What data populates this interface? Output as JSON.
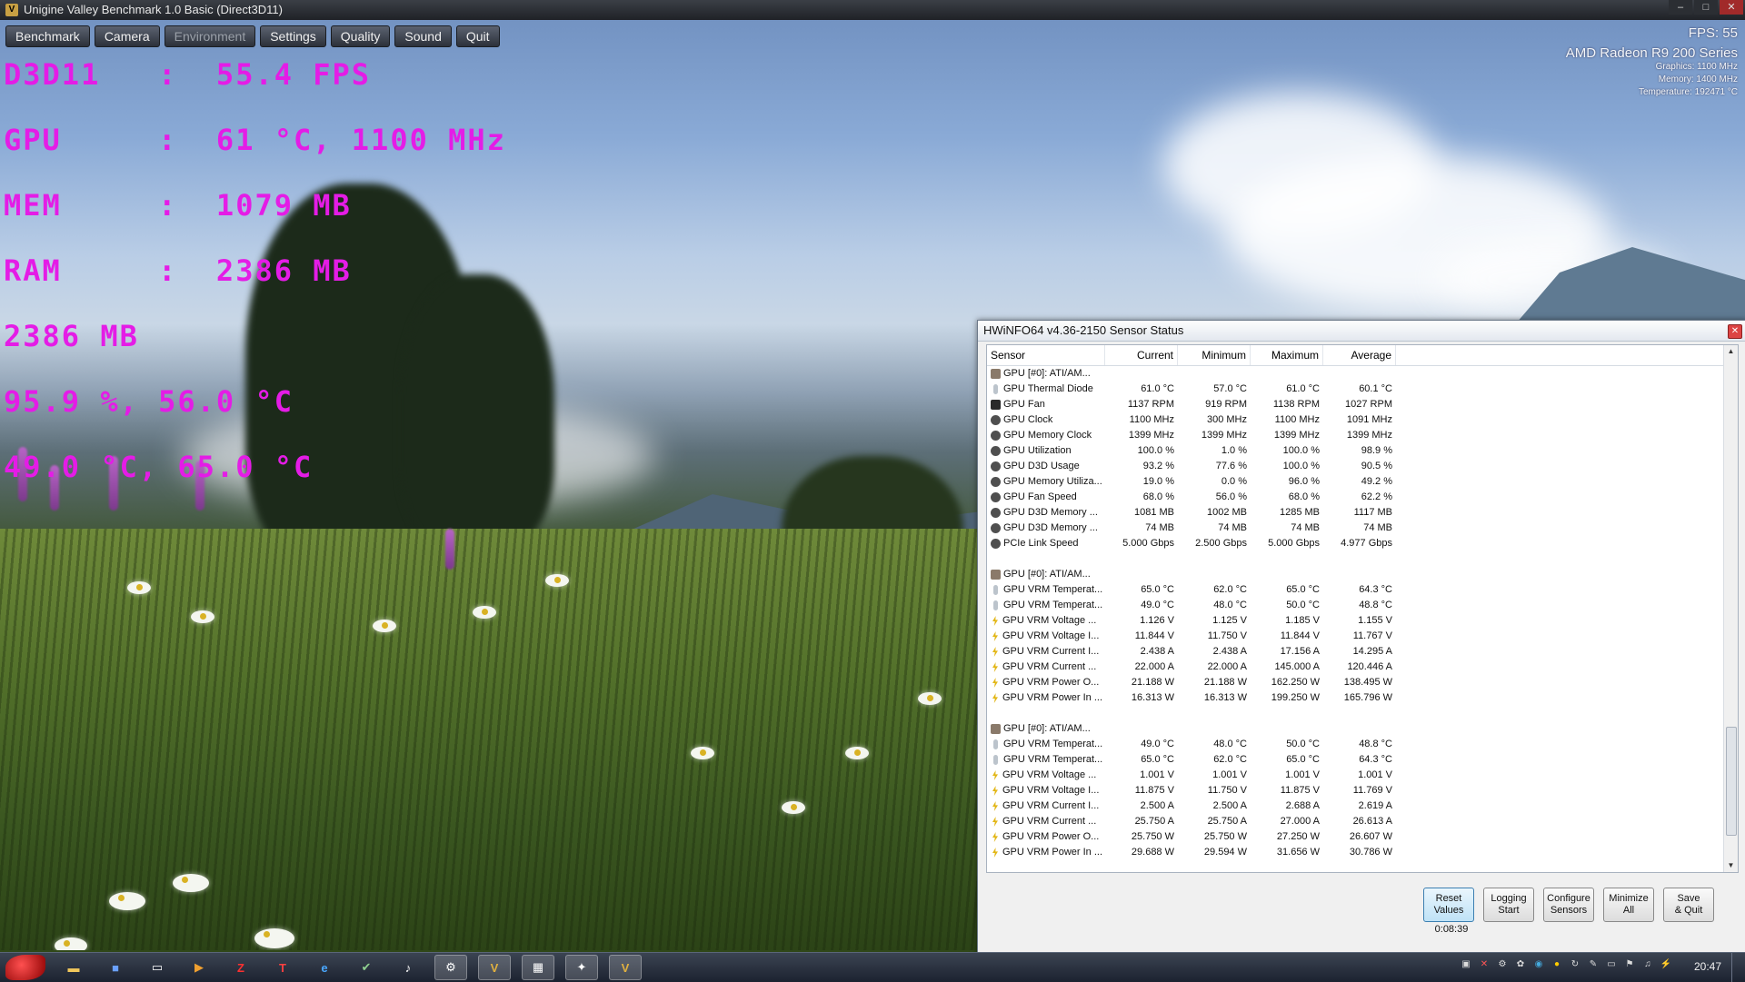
{
  "window": {
    "title": "Unigine Valley Benchmark 1.0 Basic (Direct3D11)"
  },
  "unigine_menu": [
    "Benchmark",
    "Camera",
    "Environment",
    "Settings",
    "Quality",
    "Sound",
    "Quit"
  ],
  "osd_lines": [
    "D3D11   :  55.4 FPS",
    "GPU     :  61 °C, 1100 MHz",
    "MEM     :  1079 MB",
    "RAM     :  2386 MB",
    "2386 MB",
    "95.9 %, 56.0 °C",
    "49.0 °C, 65.0 °C"
  ],
  "overlay": {
    "fps": "FPS: 55",
    "gpu_name": "AMD Radeon R9 200 Series",
    "graphics": "Graphics: 1100 MHz",
    "memory": "Memory: 1400 MHz",
    "temperature": "Temperature: 192471 °C"
  },
  "hwinfo": {
    "title": "HWiNFO64 v4.36-2150 Sensor Status",
    "columns": [
      "Sensor",
      "Current",
      "Minimum",
      "Maximum",
      "Average"
    ],
    "rows": [
      {
        "icon": "board",
        "name": "GPU [#0]: ATI/AM...",
        "cur": "",
        "min": "",
        "max": "",
        "avg": ""
      },
      {
        "icon": "therm",
        "name": "GPU Thermal Diode",
        "cur": "61.0 °C",
        "min": "57.0 °C",
        "max": "61.0 °C",
        "avg": "60.1 °C"
      },
      {
        "icon": "fan",
        "name": "GPU Fan",
        "cur": "1137 RPM",
        "min": "919 RPM",
        "max": "1138 RPM",
        "avg": "1027 RPM"
      },
      {
        "icon": "gauge",
        "name": "GPU Clock",
        "cur": "1100 MHz",
        "min": "300 MHz",
        "max": "1100 MHz",
        "avg": "1091 MHz"
      },
      {
        "icon": "gauge",
        "name": "GPU Memory Clock",
        "cur": "1399 MHz",
        "min": "1399 MHz",
        "max": "1399 MHz",
        "avg": "1399 MHz"
      },
      {
        "icon": "gauge",
        "name": "GPU Utilization",
        "cur": "100.0 %",
        "min": "1.0 %",
        "max": "100.0 %",
        "avg": "98.9 %"
      },
      {
        "icon": "gauge",
        "name": "GPU D3D Usage",
        "cur": "93.2 %",
        "min": "77.6 %",
        "max": "100.0 %",
        "avg": "90.5 %"
      },
      {
        "icon": "gauge",
        "name": "GPU Memory Utiliza...",
        "cur": "19.0 %",
        "min": "0.0 %",
        "max": "96.0 %",
        "avg": "49.2 %"
      },
      {
        "icon": "gauge",
        "name": "GPU Fan Speed",
        "cur": "68.0 %",
        "min": "56.0 %",
        "max": "68.0 %",
        "avg": "62.2 %"
      },
      {
        "icon": "gauge",
        "name": "GPU D3D Memory ...",
        "cur": "1081 MB",
        "min": "1002 MB",
        "max": "1285 MB",
        "avg": "1117 MB"
      },
      {
        "icon": "gauge",
        "name": "GPU D3D Memory ...",
        "cur": "74 MB",
        "min": "74 MB",
        "max": "74 MB",
        "avg": "74 MB"
      },
      {
        "icon": "gauge",
        "name": "PCIe Link Speed",
        "cur": "5.000 Gbps",
        "min": "2.500 Gbps",
        "max": "5.000 Gbps",
        "avg": "4.977 Gbps"
      },
      {
        "icon": "blank",
        "name": "",
        "cur": "",
        "min": "",
        "max": "",
        "avg": ""
      },
      {
        "icon": "board",
        "name": "GPU [#0]: ATI/AM...",
        "cur": "",
        "min": "",
        "max": "",
        "avg": ""
      },
      {
        "icon": "therm",
        "name": "GPU VRM Temperat...",
        "cur": "65.0 °C",
        "min": "62.0 °C",
        "max": "65.0 °C",
        "avg": "64.3 °C"
      },
      {
        "icon": "therm",
        "name": "GPU VRM Temperat...",
        "cur": "49.0 °C",
        "min": "48.0 °C",
        "max": "50.0 °C",
        "avg": "48.8 °C"
      },
      {
        "icon": "volt",
        "name": "GPU VRM Voltage ...",
        "cur": "1.126 V",
        "min": "1.125 V",
        "max": "1.185 V",
        "avg": "1.155 V"
      },
      {
        "icon": "volt",
        "name": "GPU VRM Voltage I...",
        "cur": "11.844 V",
        "min": "11.750 V",
        "max": "11.844 V",
        "avg": "11.767 V"
      },
      {
        "icon": "volt",
        "name": "GPU VRM Current I...",
        "cur": "2.438 A",
        "min": "2.438 A",
        "max": "17.156 A",
        "avg": "14.295 A"
      },
      {
        "icon": "volt",
        "name": "GPU VRM Current ...",
        "cur": "22.000 A",
        "min": "22.000 A",
        "max": "145.000 A",
        "avg": "120.446 A"
      },
      {
        "icon": "volt",
        "name": "GPU VRM Power O...",
        "cur": "21.188 W",
        "min": "21.188 W",
        "max": "162.250 W",
        "avg": "138.495 W"
      },
      {
        "icon": "volt",
        "name": "GPU VRM Power In ...",
        "cur": "16.313 W",
        "min": "16.313 W",
        "max": "199.250 W",
        "avg": "165.796 W"
      },
      {
        "icon": "blank",
        "name": "",
        "cur": "",
        "min": "",
        "max": "",
        "avg": ""
      },
      {
        "icon": "board",
        "name": "GPU [#0]: ATI/AM...",
        "cur": "",
        "min": "",
        "max": "",
        "avg": ""
      },
      {
        "icon": "therm",
        "name": "GPU VRM Temperat...",
        "cur": "49.0 °C",
        "min": "48.0 °C",
        "max": "50.0 °C",
        "avg": "48.8 °C"
      },
      {
        "icon": "therm",
        "name": "GPU VRM Temperat...",
        "cur": "65.0 °C",
        "min": "62.0 °C",
        "max": "65.0 °C",
        "avg": "64.3 °C"
      },
      {
        "icon": "volt",
        "name": "GPU VRM Voltage ...",
        "cur": "1.001 V",
        "min": "1.001 V",
        "max": "1.001 V",
        "avg": "1.001 V"
      },
      {
        "icon": "volt",
        "name": "GPU VRM Voltage I...",
        "cur": "11.875 V",
        "min": "11.750 V",
        "max": "11.875 V",
        "avg": "11.769 V"
      },
      {
        "icon": "volt",
        "name": "GPU VRM Current I...",
        "cur": "2.500 A",
        "min": "2.500 A",
        "max": "2.688 A",
        "avg": "2.619 A"
      },
      {
        "icon": "volt",
        "name": "GPU VRM Current ...",
        "cur": "25.750 A",
        "min": "25.750 A",
        "max": "27.000 A",
        "avg": "26.613 A"
      },
      {
        "icon": "volt",
        "name": "GPU VRM Power O...",
        "cur": "25.750 W",
        "min": "25.750 W",
        "max": "27.250 W",
        "avg": "26.607 W"
      },
      {
        "icon": "volt",
        "name": "GPU VRM Power In ...",
        "cur": "29.688 W",
        "min": "29.594 W",
        "max": "31.656 W",
        "avg": "30.786 W"
      }
    ],
    "buttons": [
      {
        "line1": "Reset",
        "line2": "Values",
        "active": true
      },
      {
        "line1": "Logging",
        "line2": "Start",
        "active": false
      },
      {
        "line1": "Configure",
        "line2": "Sensors",
        "active": false
      },
      {
        "line1": "Minimize",
        "line2": "All",
        "active": false
      },
      {
        "line1": "Save",
        "line2": "& Quit",
        "active": false
      }
    ],
    "timer": "0:08:39"
  },
  "taskbar": {
    "apps": [
      "folder-icon",
      "floppy-icon",
      "window-icon",
      "media-icon",
      "z-icon",
      "t-icon",
      "ie-icon",
      "check-icon",
      "audio-icon",
      "steam-icon",
      "valley-icon",
      "hwinfo-icon",
      "app-icon",
      "valley-running-icon"
    ],
    "clock": "20:47"
  }
}
